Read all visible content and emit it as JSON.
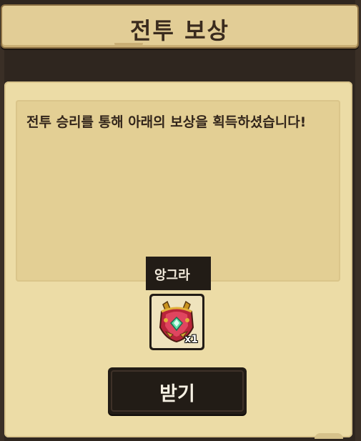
{
  "title": "전투 보상",
  "message": "전투 승리를 통해 아래의 보상을 획득하셨습니다!",
  "reward": {
    "name": "앙그라",
    "quantity": "x1",
    "icon": "armor-crest-icon"
  },
  "confirm_button": "받기",
  "colors": {
    "frame": "#2f261f",
    "panel": "#ecdca6",
    "message_box": "#e3cf94",
    "dark": "#221c16",
    "text_dark": "#33261b",
    "text_light": "#f5f0e3"
  }
}
